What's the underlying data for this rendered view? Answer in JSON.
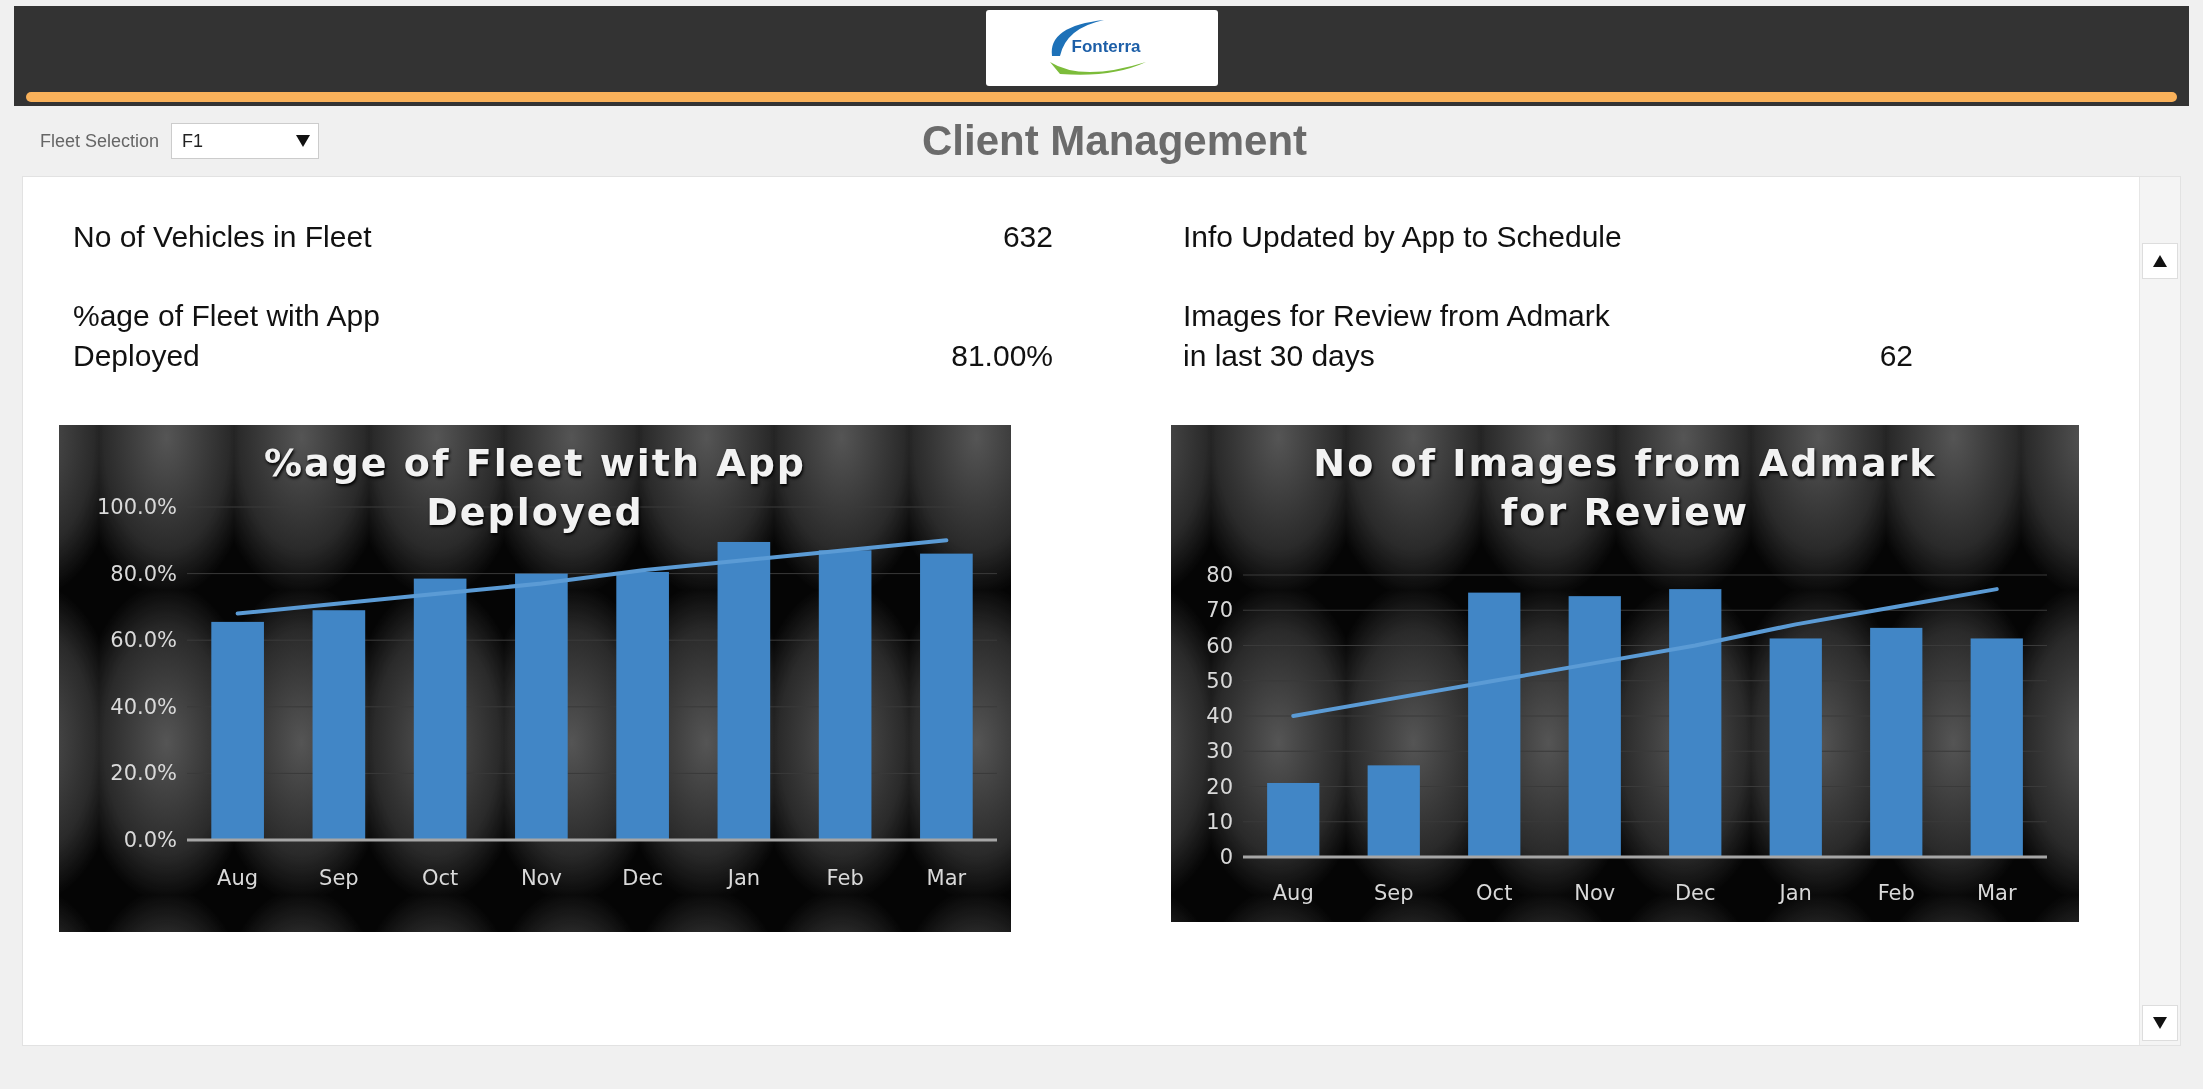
{
  "header": {
    "logo_text": "Fonterra"
  },
  "toolbar": {
    "fleet_selection": {
      "label": "Fleet Selection",
      "value": "F1"
    },
    "title": "Client Management"
  },
  "stats": [
    {
      "label": "No of Vehicles in Fleet",
      "value": "632"
    },
    {
      "label": "Info Updated by App to Schedule"
    },
    {
      "label": "%age of Fleet with App\nDeployed",
      "value": "81.00%"
    },
    {
      "label": "Images for Review from Admark\nin last 30 days",
      "value": "62"
    }
  ],
  "charts": [
    {
      "chart_data": {
        "type": "bar",
        "title": "%age of Fleet with App Deployed",
        "grid": true,
        "categories": [
          "Aug",
          "Sep",
          "Oct",
          "Nov",
          "Dec",
          "Jan",
          "Feb",
          "Mar"
        ],
        "series": [
          {
            "type": "bar",
            "color": "#4186c6",
            "values": [
              65.5,
              69,
              78.5,
              80,
              80.5,
              89.5,
              87,
              86
            ]
          },
          {
            "type": "line",
            "color": "#5b9bd5",
            "values": [
              68,
              71,
              74,
              77,
              81,
              84,
              87,
              90
            ]
          }
        ],
        "ylim": [
          0,
          100
        ],
        "yticks": [
          {
            "value": 0,
            "label": "0.0%"
          },
          {
            "value": 20,
            "label": "20.0%"
          },
          {
            "value": 40,
            "label": "40.0%"
          },
          {
            "value": 60,
            "label": "60.0%"
          },
          {
            "value": 80,
            "label": "80.0%"
          },
          {
            "value": 100,
            "label": "100.0%"
          }
        ]
      }
    },
    {
      "chart_data": {
        "type": "bar",
        "title": "No of Images from Admark for Review",
        "grid": true,
        "categories": [
          "Aug",
          "Sep",
          "Oct",
          "Nov",
          "Dec",
          "Jan",
          "Feb",
          "Mar"
        ],
        "series": [
          {
            "type": "bar",
            "color": "#4186c6",
            "values": [
              21,
              26,
              75,
              74,
              76,
              62,
              65,
              62
            ]
          },
          {
            "type": "line",
            "color": "#5b9bd5",
            "values": [
              40,
              45,
              50,
              55,
              60,
              66,
              71,
              76
            ]
          }
        ],
        "ylim": [
          0,
          80
        ],
        "yticks": [
          0,
          10,
          20,
          30,
          40,
          50,
          60,
          70,
          80
        ]
      }
    }
  ]
}
